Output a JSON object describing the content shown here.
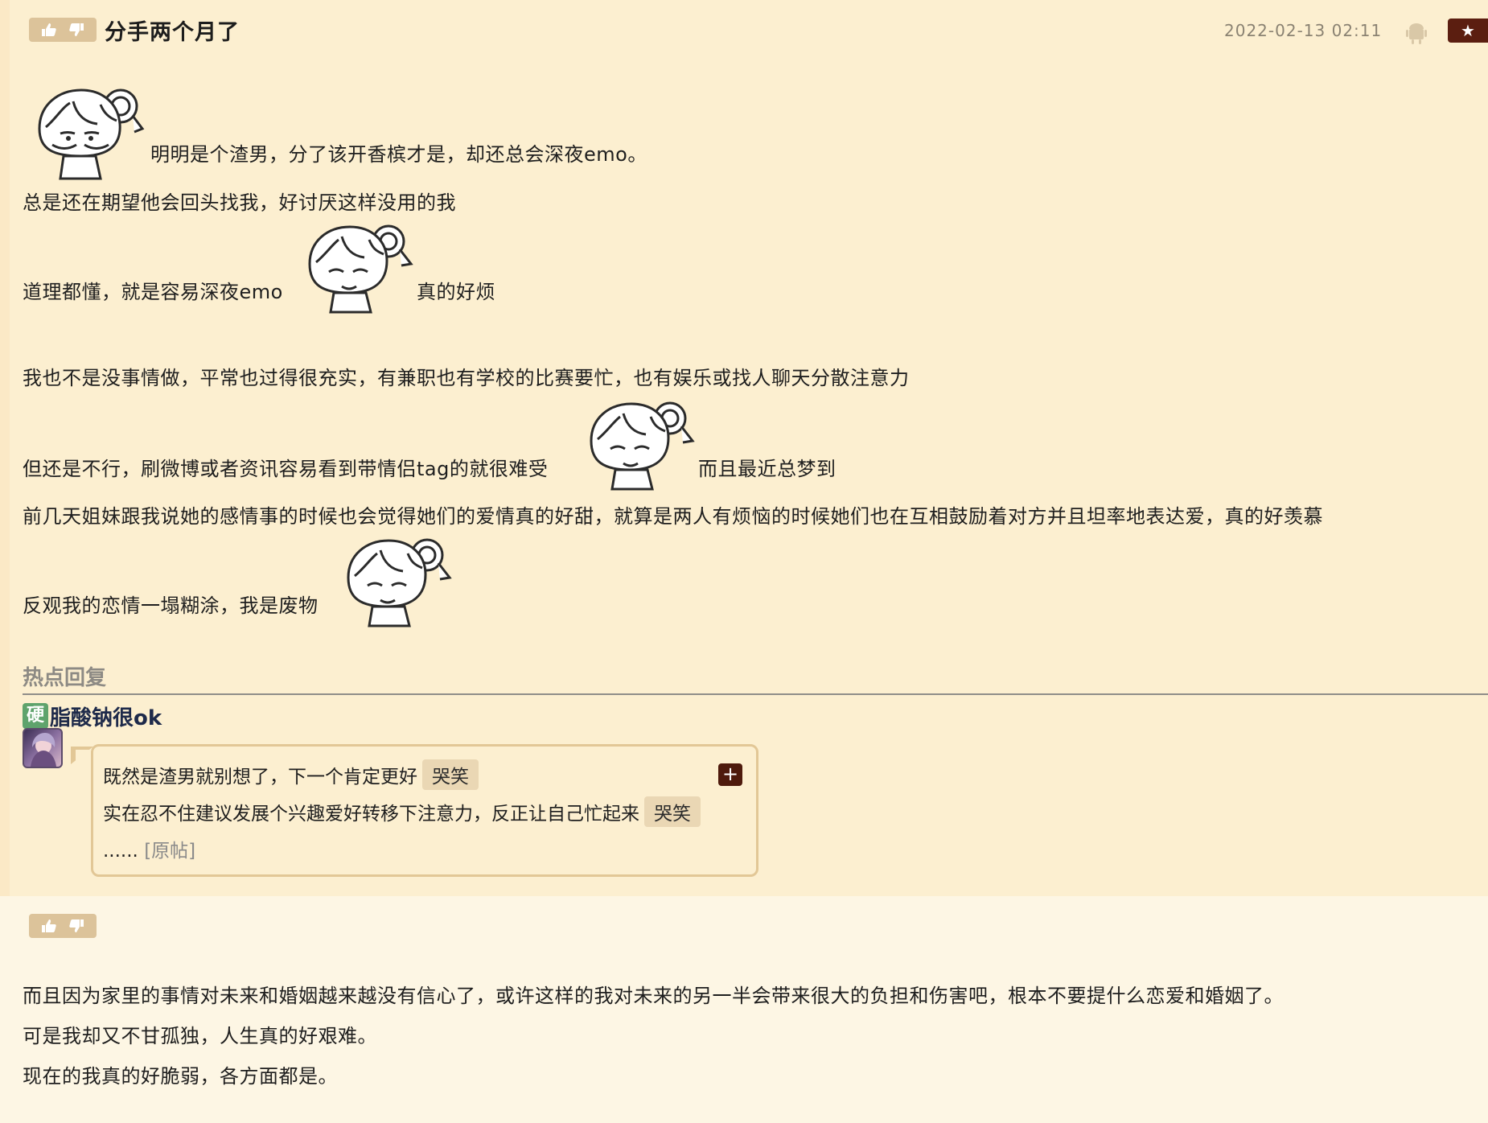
{
  "post1": {
    "title": "分手两个月了",
    "datetime": "2022-02-13 02:11",
    "lines": [
      "明明是个渣男，分了该开香槟才是，却还总会深夜emo。",
      "总是还在期望他会回头找我，好讨厌这样没用的我",
      "道理都懂，就是容易深夜emo",
      "真的好烦",
      "我也不是没事情做，平常也过得很充实，有兼职也有学校的比赛要忙，也有娱乐或找人聊天分散注意力",
      "但还是不行，刷微博或者资讯容易看到带情侣tag的就很难受",
      "而且最近总梦到",
      "前几天姐妹跟我说她的感情事的时候也会觉得她们的爱情真的好甜，就算是两人有烦恼的时候她们也在互相鼓励着对方并且坦率地表达爱，真的好羡慕",
      "反观我的恋情一塌糊涂，我是废物"
    ]
  },
  "hot_reply": {
    "section_title": "热点回复",
    "badge": "硬",
    "username": "脂酸钠很ok",
    "lines": [
      "既然是渣男就别想了，下一个肯定更好",
      "实在忍不住建议发展个兴趣爱好转移下注意力，反正让自己忙起来"
    ],
    "emoji_tag": "哭笑",
    "ellipsis": "......",
    "original_link": "[原帖]",
    "plus": "+"
  },
  "post2": {
    "lines": [
      "而且因为家里的事情对未来和婚姻越来越没有信心了，或许这样的我对未来的另一半会带来很大的负担和伤害吧，根本不要提什么恋爱和婚姻了。",
      "可是我却又不甘孤独，人生真的好艰难。",
      "现在的我真的好脆弱，各方面都是。"
    ]
  },
  "icons": {
    "upvote": "thumbs-up-icon",
    "downvote": "thumbs-down-icon",
    "android": "android-icon",
    "star": "star-icon"
  },
  "colors": {
    "vote_bg": "#dcc39a",
    "star_bg": "#5b1e10",
    "badge": "#5fa36c",
    "username": "#1e2a4a"
  }
}
